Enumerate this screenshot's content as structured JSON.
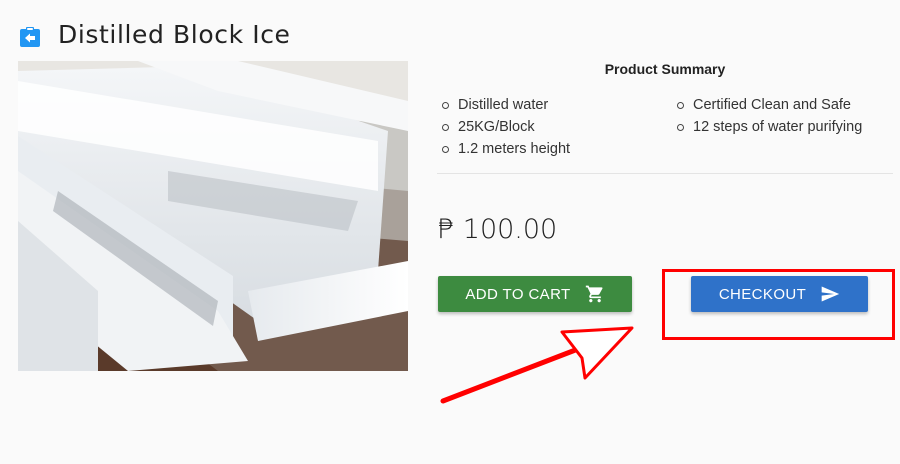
{
  "header": {
    "title": "Distilled Block Ice",
    "back_icon": "back-arrow-icon"
  },
  "product": {
    "image_alt": "Blocks of distilled ice",
    "summary_title": "Product Summary",
    "features_left": [
      "Distilled water",
      "25KG/Block",
      "1.2 meters height"
    ],
    "features_right": [
      "Certified Clean and Safe",
      "12 steps of water purifying"
    ],
    "price": "₱ 100.00"
  },
  "actions": {
    "add_to_cart_label": "ADD TO CART",
    "add_to_cart_icon": "cart-icon",
    "checkout_label": "CHECKOUT",
    "checkout_icon": "send-icon"
  },
  "colors": {
    "add_to_cart": "#3d8b40",
    "checkout": "#2f72c9",
    "annotation": "#ff0000",
    "back_icon": "#2196f3"
  }
}
